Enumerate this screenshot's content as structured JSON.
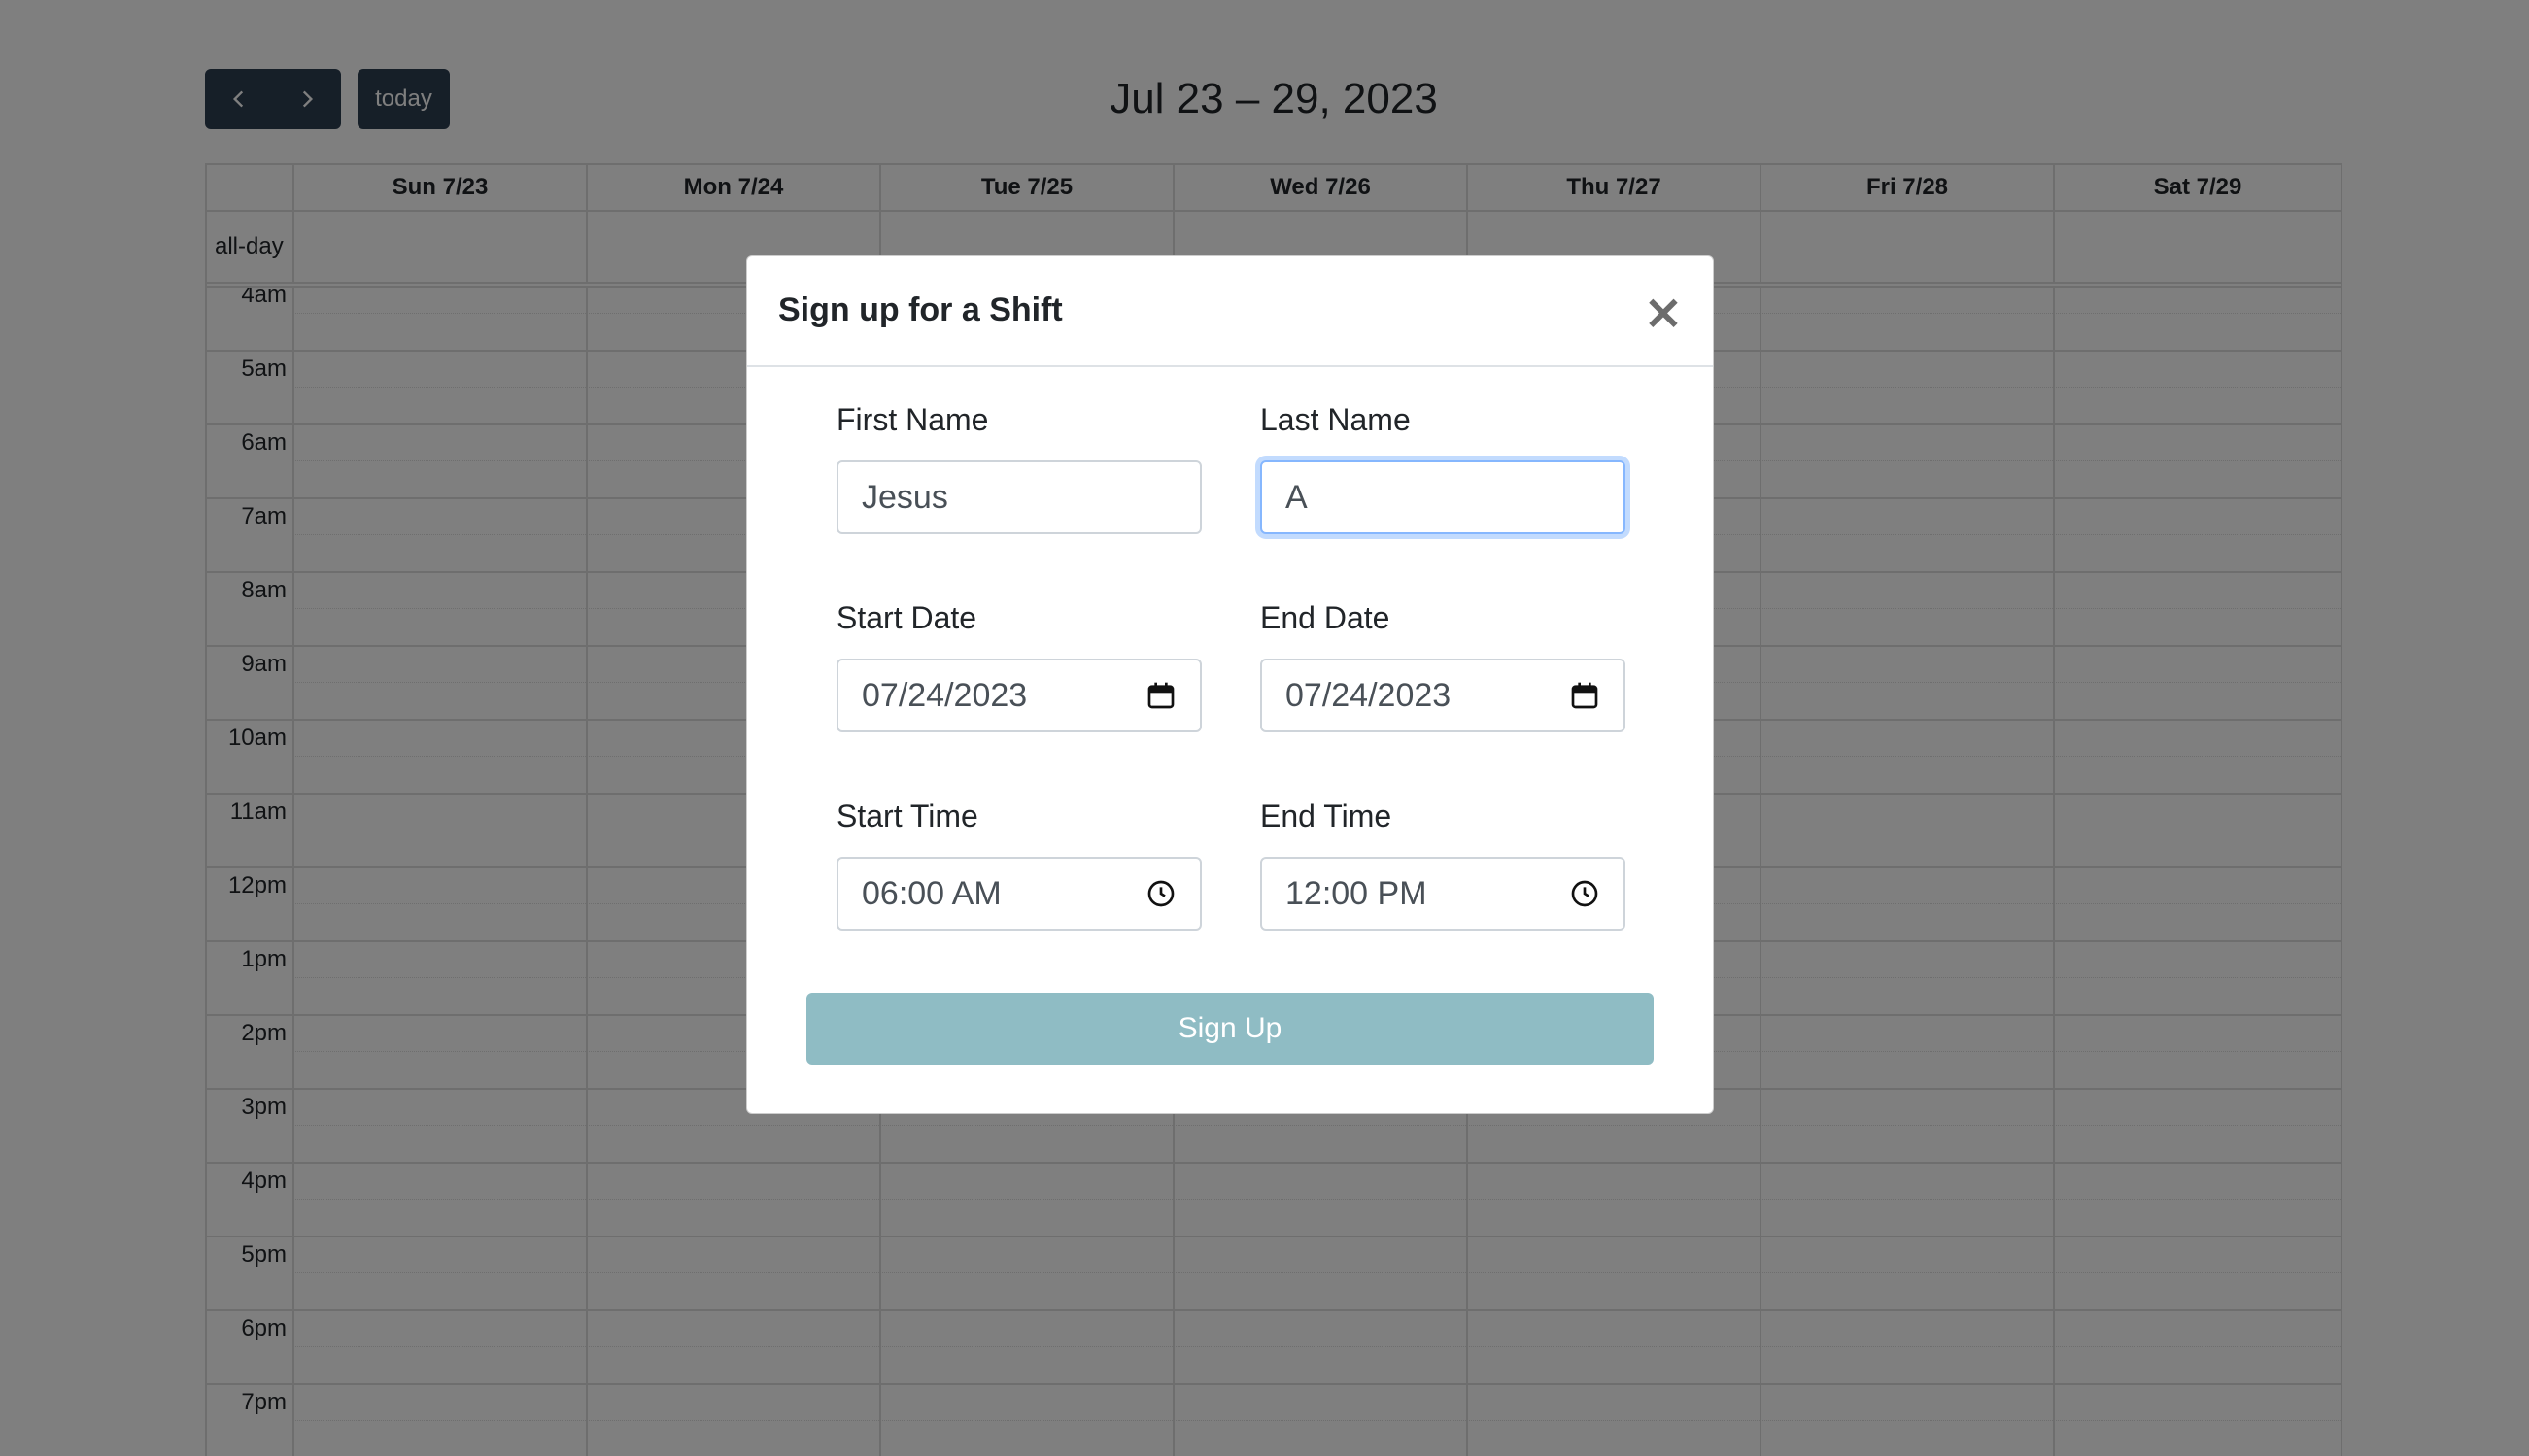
{
  "calendar": {
    "title": "Jul 23 – 29, 2023",
    "today_label": "today",
    "allday_label": "all-day",
    "days": [
      "Sun 7/23",
      "Mon 7/24",
      "Tue 7/25",
      "Wed 7/26",
      "Thu 7/27",
      "Fri 7/28",
      "Sat 7/29"
    ],
    "times": [
      "4am",
      "5am",
      "6am",
      "7am",
      "8am",
      "9am",
      "10am",
      "11am",
      "12pm",
      "1pm",
      "2pm",
      "3pm",
      "4pm",
      "5pm",
      "6pm",
      "7pm"
    ]
  },
  "modal": {
    "title": "Sign up for a Shift",
    "close_glyph": "×",
    "first_name": {
      "label": "First Name",
      "value": "Jesus"
    },
    "last_name": {
      "label": "Last Name",
      "value": "A"
    },
    "start_date": {
      "label": "Start Date",
      "value": "07/24/2023"
    },
    "end_date": {
      "label": "End Date",
      "value": "07/24/2023"
    },
    "start_time": {
      "label": "Start Time",
      "value": "06:00 AM"
    },
    "end_time": {
      "label": "End Time",
      "value": "12:00 PM"
    },
    "submit_label": "Sign Up"
  },
  "icons": {
    "prev": "chevron-left-icon",
    "next": "chevron-right-icon",
    "date": "calendar-icon",
    "time": "clock-icon",
    "close": "close-icon"
  },
  "colors": {
    "toolbar_button": "#2c3e50",
    "submit_button": "#8fbcc4",
    "focus_ring": "#86b7fe"
  }
}
